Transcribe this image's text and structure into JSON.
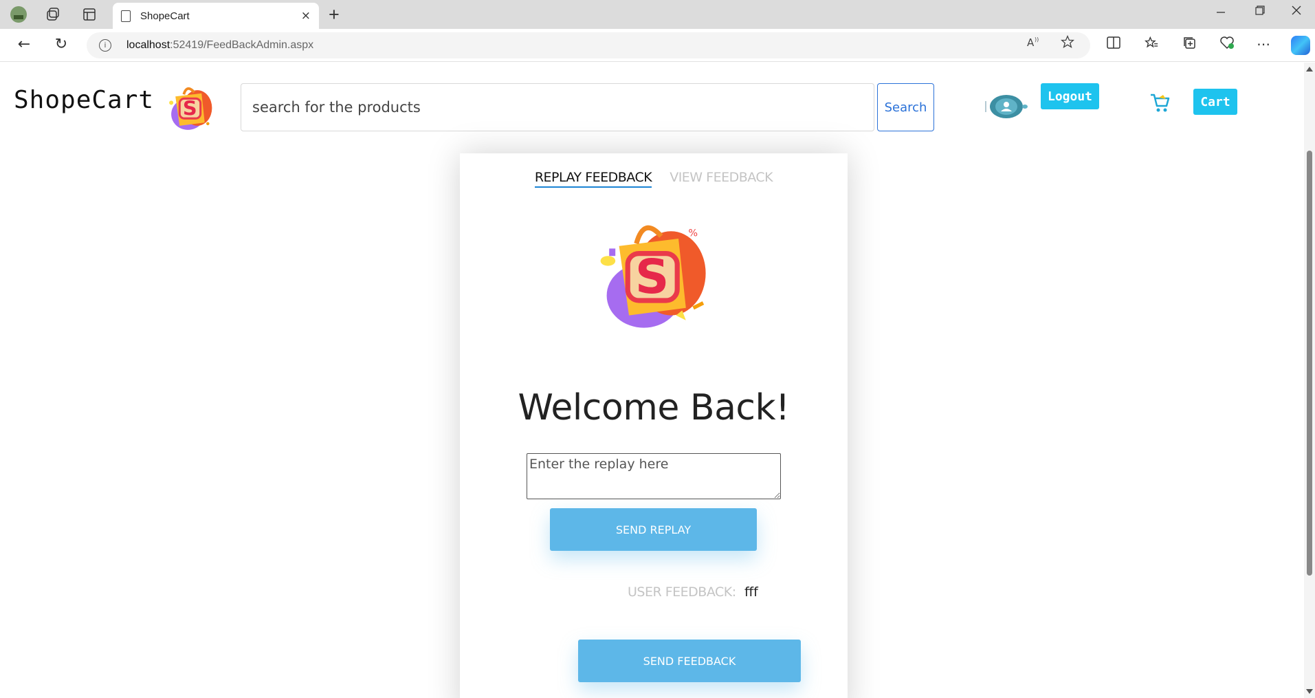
{
  "browser": {
    "tab_title": "ShopeCart",
    "url_host": "localhost",
    "url_path": ":52419/FeedBackAdmin.aspx",
    "new_tab_label": "+",
    "close_tab_label": "×",
    "back_label": "←",
    "refresh_label": "↻",
    "more_label": "⋯"
  },
  "header": {
    "brand": "ShopeCart",
    "search_placeholder": "search for the products",
    "search_button": "Search",
    "logout_button": "Logout",
    "cart_button": "Cart"
  },
  "card": {
    "tabs": [
      {
        "label": "REPLAY FEEDBACK",
        "active": true
      },
      {
        "label": "VIEW FEEDBACK",
        "active": false
      }
    ],
    "heading": "Welcome Back!",
    "replay_placeholder": "Enter the replay here",
    "send_replay_button": "SEND REPLAY",
    "user_feedback_label": "USER FEEDBACK:",
    "user_feedback_value": "fff",
    "send_feedback_button": "SEND FEEDBACK"
  },
  "colors": {
    "accent_cyan": "#1ec3ee",
    "button_blue": "#5db7e8",
    "link_blue": "#2a71d8"
  }
}
